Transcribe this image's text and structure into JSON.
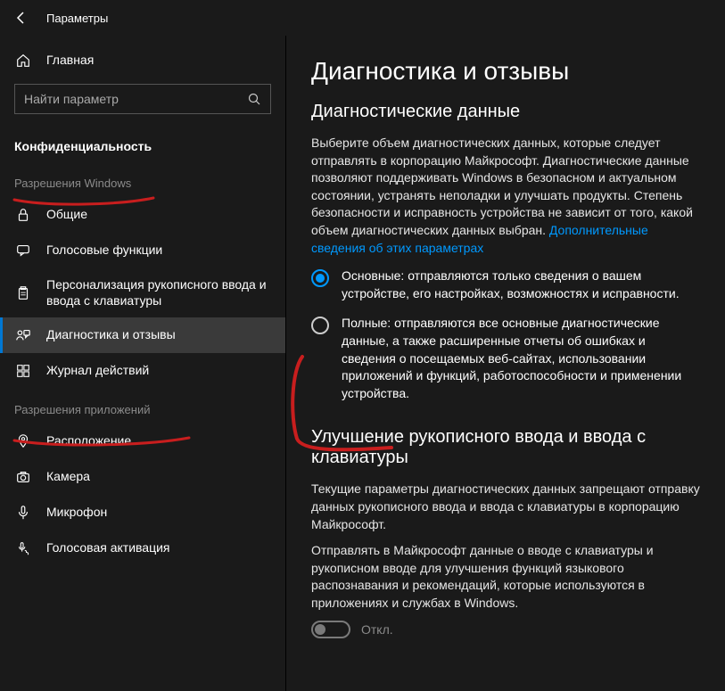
{
  "window": {
    "title": "Параметры"
  },
  "sidebar": {
    "home_label": "Главная",
    "search_placeholder": "Найти параметр",
    "section_label": "Конфиденциальность",
    "group1_label": "Разрешения Windows",
    "group2_label": "Разрешения приложений",
    "items_g1": [
      {
        "label": "Общие"
      },
      {
        "label": "Голосовые функции"
      },
      {
        "label": "Персонализация рукописного ввода и ввода с клавиатуры"
      },
      {
        "label": "Диагностика и отзывы"
      },
      {
        "label": "Журнал действий"
      }
    ],
    "items_g2": [
      {
        "label": "Расположение"
      },
      {
        "label": "Камера"
      },
      {
        "label": "Микрофон"
      },
      {
        "label": "Голосовая активация"
      }
    ]
  },
  "content": {
    "page_title": "Диагностика и отзывы",
    "section1_title": "Диагностические данные",
    "section1_body": "Выберите объем диагностических данных, которые следует отправлять в корпорацию Майкрософт. Диагностические данные позволяют поддерживать Windows в безопасном и актуальном состоянии, устранять неполадки и улучшать продукты. Степень безопасности и исправность устройства не зависит от того, какой объем диагностических данных выбран. ",
    "section1_link": "Дополнительные сведения об этих параметрах",
    "radio_basic": "Основные: отправляются только сведения о вашем устройстве, его настройках, возможностях и исправности.",
    "radio_full": "Полные: отправляются все основные диагностические данные, а также расширенные отчеты об ошибках и сведения о посещаемых веб-сайтах, использовании приложений и функций, работоспособности и применении устройства.",
    "section2_title": "Улучшение рукописного ввода и ввода с клавиатуры",
    "section2_warn": "Текущие параметры диагностических данных запрещают отправку данных рукописного ввода и ввода с клавиатуры в корпорацию Майкрософт.",
    "section2_body": "Отправлять в Майкрософт данные о вводе с клавиатуры и рукописном вводе для улучшения функций языкового распознавания и рекомендаций, которые используются в приложениях и службах в Windows.",
    "toggle_label": "Откл."
  }
}
